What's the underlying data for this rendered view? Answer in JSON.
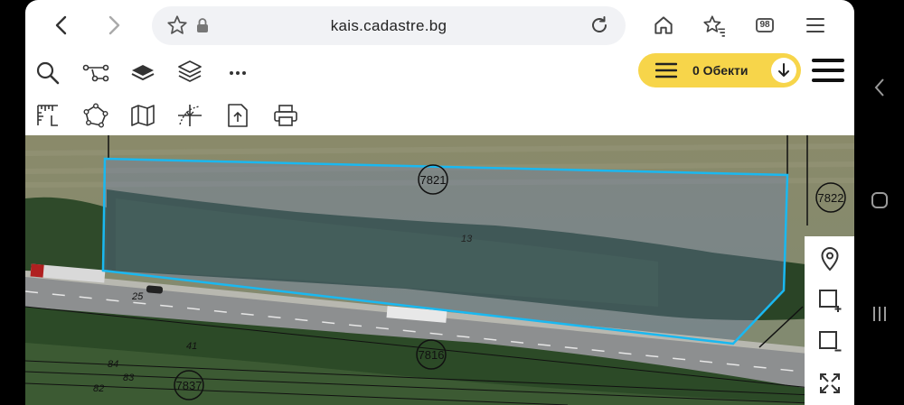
{
  "browser": {
    "url": "kais.cadastre.bg",
    "tab_count": "98"
  },
  "toolbar": {
    "objects_label": "0 Обекти"
  },
  "map": {
    "parcel_labels": {
      "p7821": "7821",
      "p7822": "7822",
      "p7816": "7816",
      "p7837": "7837"
    },
    "small_labels": {
      "l13": "13",
      "l25": "25",
      "l41": "41",
      "l84": "84",
      "l83": "83",
      "l82": "82"
    }
  }
}
